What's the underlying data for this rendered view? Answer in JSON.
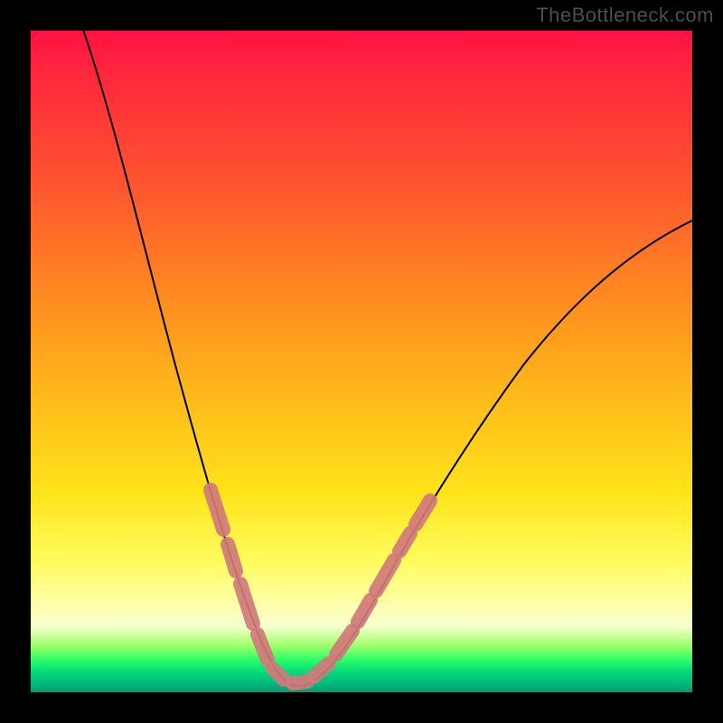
{
  "watermark": "TheBottleneck.com",
  "colors": {
    "frame": "#000000",
    "curve": "#000000",
    "bead": "#d07a7a",
    "gradient_top": "#ff1243",
    "gradient_bottom": "#009a75"
  },
  "chart_data": {
    "type": "line",
    "title": "",
    "xlabel": "",
    "ylabel": "",
    "xlim": [
      0,
      100
    ],
    "ylim": [
      0,
      100
    ],
    "x": [
      0,
      5,
      10,
      15,
      20,
      25,
      30,
      33,
      35,
      40,
      45,
      50,
      55,
      60,
      65,
      70,
      75,
      80,
      85,
      90,
      95,
      100
    ],
    "values": [
      100,
      90,
      78,
      65,
      50,
      35,
      20,
      10,
      3,
      0,
      5,
      14,
      24,
      33,
      42,
      50,
      56,
      62,
      66,
      69,
      71,
      72
    ],
    "annotations": [
      {
        "note": "highlighted bead segments on left descent",
        "x_range": [
          26,
          34
        ],
        "style": "bead"
      },
      {
        "note": "highlighted bead segments at trough",
        "x_range": [
          34,
          42
        ],
        "style": "bead"
      },
      {
        "note": "highlighted bead segments on right ascent",
        "x_range": [
          42,
          52
        ],
        "style": "bead"
      }
    ],
    "grid": false,
    "legend": false
  }
}
